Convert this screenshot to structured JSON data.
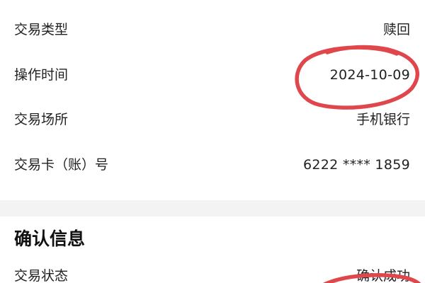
{
  "details": {
    "rows": [
      {
        "label": "交易类型",
        "value": "赎回"
      },
      {
        "label": "操作时间",
        "value": "2024-10-09"
      },
      {
        "label": "交易场所",
        "value": "手机银行"
      },
      {
        "label": "交易卡（账）号",
        "value": "6222 **** 1859"
      }
    ]
  },
  "confirm_section": {
    "title": "确认信息",
    "rows": [
      {
        "label": "交易状态",
        "value": "确认成功"
      }
    ]
  },
  "annotation": {
    "color": "#e0474c"
  }
}
